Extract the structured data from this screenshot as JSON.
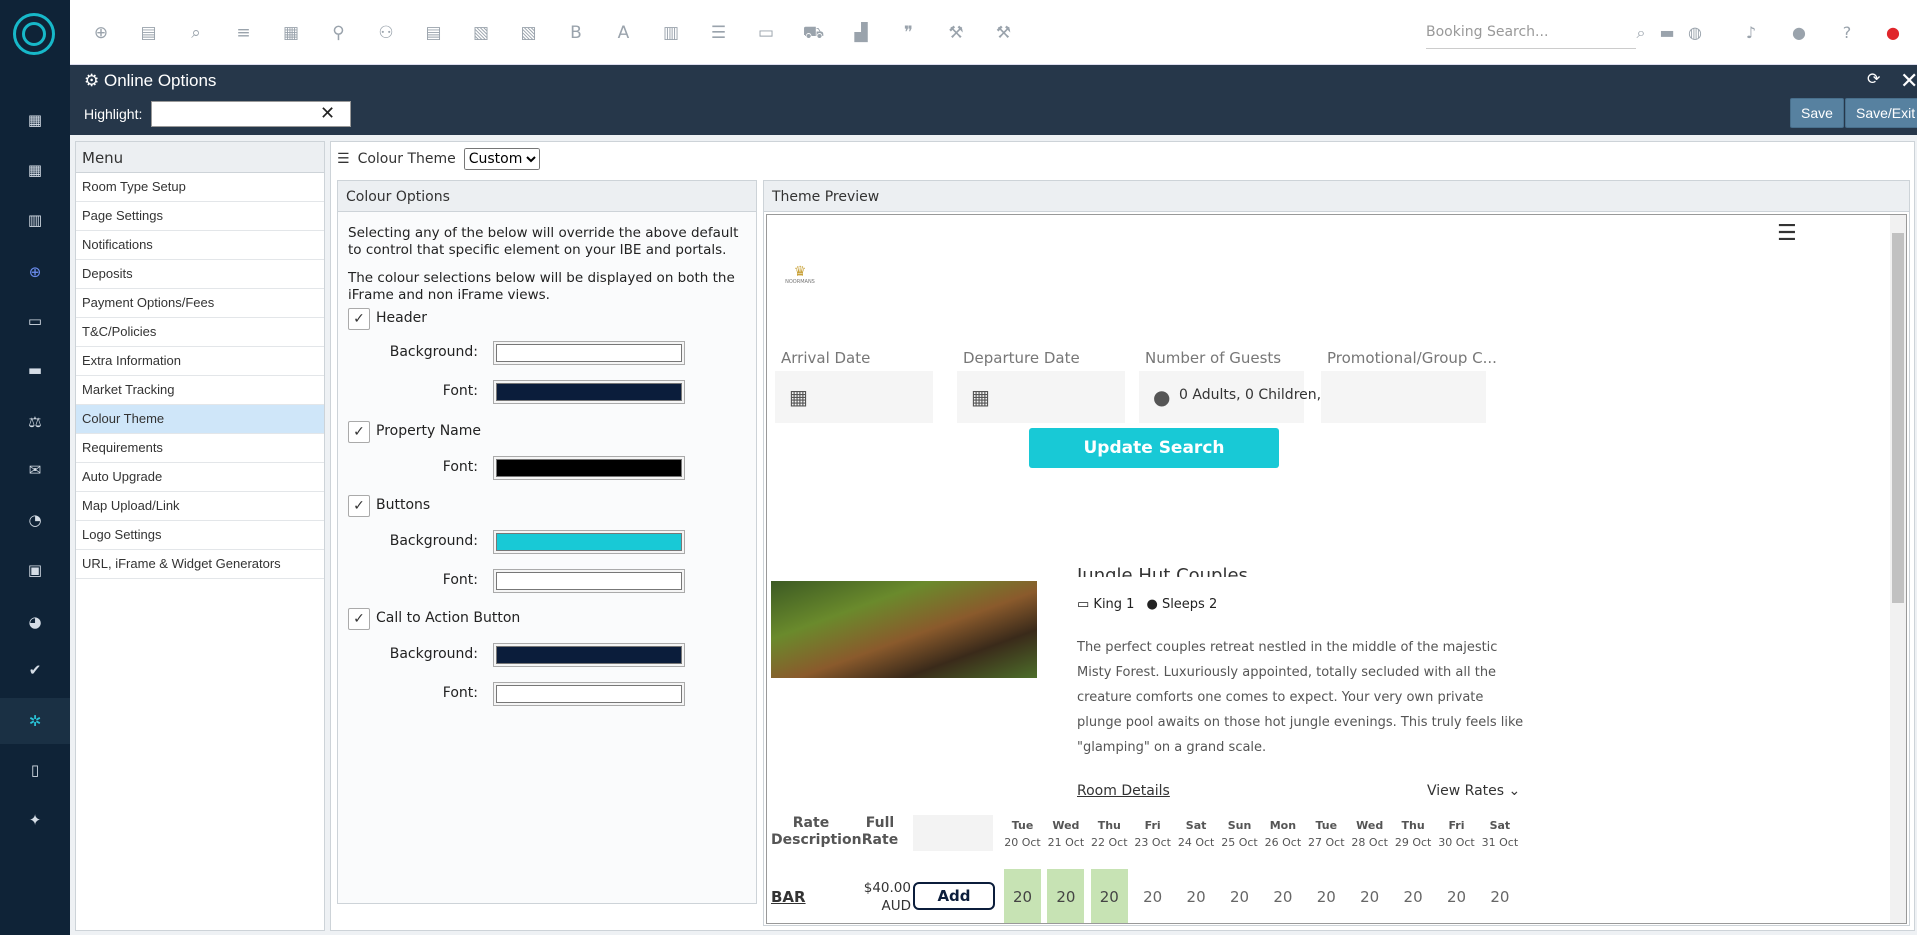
{
  "left_nav": {
    "items": [
      {
        "icon": "grid-icon"
      },
      {
        "icon": "grid-icon"
      },
      {
        "icon": "chart-icon"
      },
      {
        "icon": "plus-circle-icon"
      },
      {
        "icon": "card-icon"
      },
      {
        "icon": "bed-icon"
      },
      {
        "icon": "scale-icon"
      },
      {
        "icon": "mail-icon"
      },
      {
        "icon": "pie-icon"
      },
      {
        "icon": "briefcase-icon"
      },
      {
        "icon": "gauge-icon"
      },
      {
        "icon": "check-icon"
      },
      {
        "icon": "gear-icon"
      },
      {
        "icon": "building-icon"
      },
      {
        "icon": "bird-icon"
      }
    ]
  },
  "top_nav": {
    "icons": [
      "plus-circle-icon",
      "calendar-icon",
      "search-icon",
      "sliders-icon",
      "grid-icon",
      "pin-icon",
      "users-icon",
      "document-icon",
      "map-icon",
      "map-icon",
      "bold-icon",
      "font-icon",
      "chart-icon",
      "checklist-icon",
      "card-icon",
      "cart-icon",
      "factory-icon",
      "quote-icon",
      "wrench-icon",
      "hammer-icon"
    ],
    "booking_search_placeholder": "Booking Search..."
  },
  "titlebar": {
    "title": "Online Options",
    "highlight_label": "Highlight:",
    "save_label": "Save",
    "save_exit_label": "Save/Exit"
  },
  "menu": {
    "header": "Menu",
    "items": [
      "Room Type Setup",
      "Page Settings",
      "Notifications",
      "Deposits",
      "Payment Options/Fees",
      "T&C/Policies",
      "Extra Information",
      "Market Tracking",
      "Colour Theme",
      "Requirements",
      "Auto Upgrade",
      "Map Upload/Link",
      "Logo Settings",
      "URL, iFrame & Widget Generators"
    ],
    "selected": "Colour Theme"
  },
  "colour_theme": {
    "label": "Colour Theme",
    "value": "Custom"
  },
  "colour_options": {
    "header": "Colour Options",
    "intro1": "Selecting any of the below will override the above default to control that specific element on your IBE and portals.",
    "intro2": "The colour selections below will be displayed on both the iFrame and non iFrame views.",
    "groups": [
      {
        "label": "Header",
        "fields": [
          {
            "label": "Background:",
            "color": "#ffffff"
          },
          {
            "label": "Font:",
            "color": "#0b1d3b"
          }
        ]
      },
      {
        "label": "Property Name",
        "fields": [
          {
            "label": "Font:",
            "color": "#000000"
          }
        ]
      },
      {
        "label": "Buttons",
        "fields": [
          {
            "label": "Background:",
            "color": "#18c9d6"
          },
          {
            "label": "Font:",
            "color": "#ffffff"
          }
        ]
      },
      {
        "label": "Call to Action Button",
        "fields": [
          {
            "label": "Background:",
            "color": "#0b1d3b"
          },
          {
            "label": "Font:",
            "color": "#ffffff"
          }
        ]
      }
    ]
  },
  "preview": {
    "header": "Theme Preview",
    "logo_text": "NOORMANS",
    "fields": [
      "Arrival Date",
      "Departure Date",
      "Number of Guests",
      "Promotional/Group C..."
    ],
    "guests_value": "0 Adults, 0 Children,",
    "update_label": "Update Search",
    "room_title": "Jungle Hut Couples",
    "beds": "King 1",
    "sleeps": "Sleeps 2",
    "description": "The perfect couples retreat nestled in the middle of the majestic Misty Forest. Luxuriously appointed, totally secluded with all the creature comforts one comes to expect. Your very own private plunge pool awaits on those hot jungle evenings. This truly feels like \"glamping\" on a grand scale.",
    "room_details": "Room Details",
    "view_rates": "View Rates",
    "rate_desc_header": "Rate Description",
    "full_rate_header": "Full Rate",
    "days": [
      {
        "d": "Tue",
        "dt": "20 Oct"
      },
      {
        "d": "Wed",
        "dt": "21 Oct"
      },
      {
        "d": "Thu",
        "dt": "22 Oct"
      },
      {
        "d": "Fri",
        "dt": "23 Oct"
      },
      {
        "d": "Sat",
        "dt": "24 Oct"
      },
      {
        "d": "Sun",
        "dt": "25 Oct"
      },
      {
        "d": "Mon",
        "dt": "26 Oct"
      },
      {
        "d": "Tue",
        "dt": "27 Oct"
      },
      {
        "d": "Wed",
        "dt": "28 Oct"
      },
      {
        "d": "Thu",
        "dt": "29 Oct"
      },
      {
        "d": "Fri",
        "dt": "30 Oct"
      },
      {
        "d": "Sat",
        "dt": "31 Oct"
      }
    ],
    "rate_row": {
      "name": "BAR",
      "price": "$40.00",
      "currency": "AUD",
      "add_label": "Add",
      "values": [
        "20",
        "20",
        "20",
        "20",
        "20",
        "20",
        "20",
        "20",
        "20",
        "20",
        "20",
        "20"
      ],
      "highlighted": [
        0,
        1,
        2
      ]
    }
  }
}
